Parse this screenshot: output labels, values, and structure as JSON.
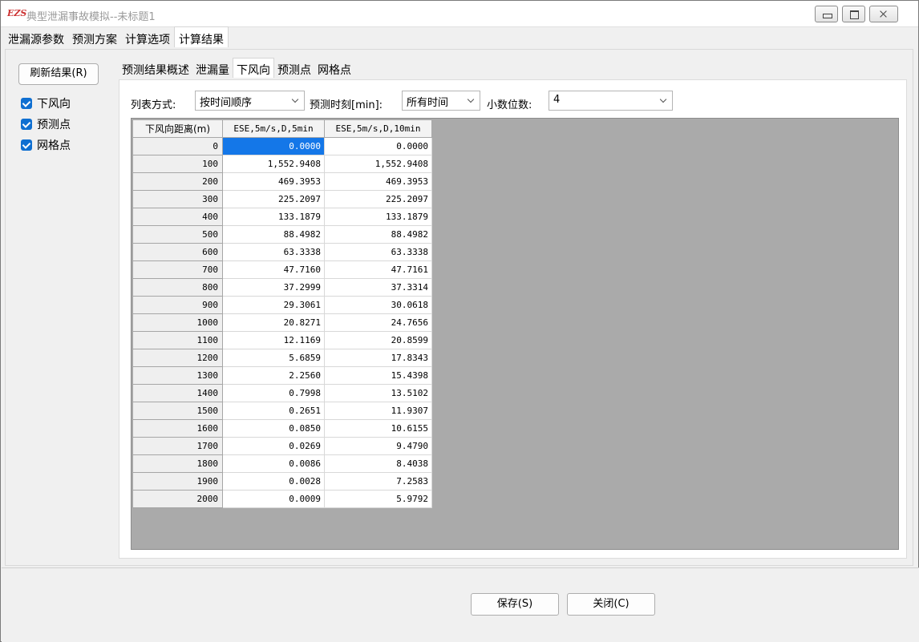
{
  "window": {
    "title": "典型泄漏事故模拟--未标题1",
    "app_icon": "EZS"
  },
  "top_tabs": [
    {
      "label": "泄漏源参数"
    },
    {
      "label": "预测方案"
    },
    {
      "label": "计算选项"
    },
    {
      "label": "计算结果"
    }
  ],
  "left_panel": {
    "refresh_label": "刷新结果(R)",
    "checks": [
      {
        "label": "下风向",
        "checked": true
      },
      {
        "label": "预测点",
        "checked": true
      },
      {
        "label": "网格点",
        "checked": true
      }
    ]
  },
  "sub_tabs": [
    {
      "label": "预测结果概述"
    },
    {
      "label": "泄漏量"
    },
    {
      "label": "下风向"
    },
    {
      "label": "预测点"
    },
    {
      "label": "网格点"
    }
  ],
  "controls": {
    "list_mode_label": "列表方式:",
    "list_mode_value": "按时间顺序",
    "predict_time_label": "预测时刻[min]:",
    "predict_time_value": "所有时间",
    "decimals_label": "小数位数:",
    "decimals_value": "4"
  },
  "table": {
    "headers": [
      "下风向距离(m)",
      "ESE,5m/s,D,5min",
      "ESE,5m/s,D,10min"
    ],
    "rows": [
      [
        "0",
        "0.0000",
        "0.0000"
      ],
      [
        "100",
        "1,552.9408",
        "1,552.9408"
      ],
      [
        "200",
        "469.3953",
        "469.3953"
      ],
      [
        "300",
        "225.2097",
        "225.2097"
      ],
      [
        "400",
        "133.1879",
        "133.1879"
      ],
      [
        "500",
        "88.4982",
        "88.4982"
      ],
      [
        "600",
        "63.3338",
        "63.3338"
      ],
      [
        "700",
        "47.7160",
        "47.7161"
      ],
      [
        "800",
        "37.2999",
        "37.3314"
      ],
      [
        "900",
        "29.3061",
        "30.0618"
      ],
      [
        "1000",
        "20.8271",
        "24.7656"
      ],
      [
        "1100",
        "12.1169",
        "20.8599"
      ],
      [
        "1200",
        "5.6859",
        "17.8343"
      ],
      [
        "1300",
        "2.2560",
        "15.4398"
      ],
      [
        "1400",
        "0.7998",
        "13.5102"
      ],
      [
        "1500",
        "0.2651",
        "11.9307"
      ],
      [
        "1600",
        "0.0850",
        "10.6155"
      ],
      [
        "1700",
        "0.0269",
        "9.4790"
      ],
      [
        "1800",
        "0.0086",
        "8.4038"
      ],
      [
        "1900",
        "0.0028",
        "7.2583"
      ],
      [
        "2000",
        "0.0009",
        "5.9792"
      ]
    ]
  },
  "buttons": {
    "save_label": "保存(S)",
    "close_label": "关闭(C)"
  }
}
